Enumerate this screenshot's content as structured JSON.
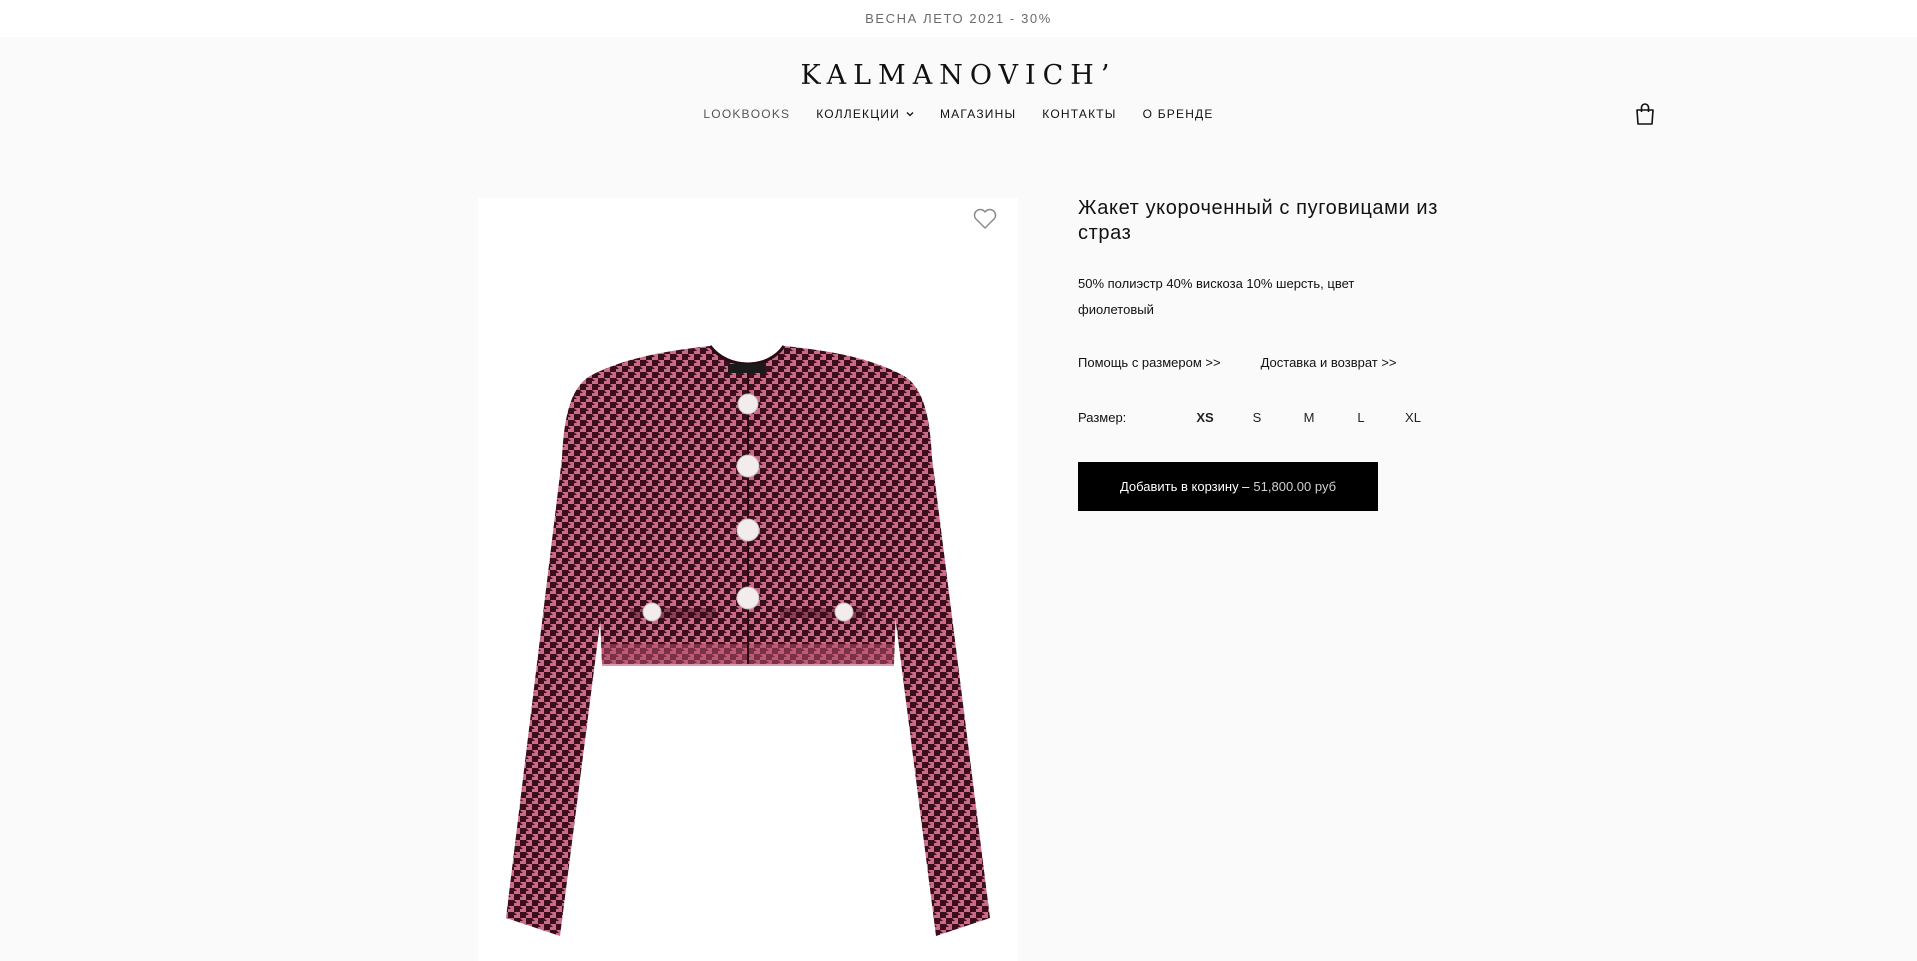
{
  "promo": {
    "text": "ВЕСНА ЛЕТО 2021 - 30%"
  },
  "brand": {
    "logo": "KALMANOVICH’"
  },
  "nav": {
    "lookbooks": "LOOKBOOKS",
    "collections": "КОЛЛЕКЦИИ",
    "stores": "МАГАЗИНЫ",
    "contacts": "КОНТАКТЫ",
    "about": "О БРЕНДЕ"
  },
  "icons": {
    "cart": "shopping-bag-icon",
    "wishlist": "heart-icon",
    "dropdown": "chevron-down-icon"
  },
  "product": {
    "title": "Жакет укороченный с пуговицами из страз",
    "composition": "50% полиэстр 40% вискоза 10% шерсть, цвет фиолетовый",
    "size_help": "Помощь с размером >>",
    "delivery": "Доставка и возврат >>",
    "size_label": "Размер:",
    "sizes": [
      "XS",
      "S",
      "M",
      "L",
      "XL"
    ],
    "selected_size": "XS",
    "add_to_cart": "Добавить в корзину –",
    "price": "51,800.00 руб"
  },
  "colors": {
    "accent": "#000000",
    "background": "#fafafa",
    "jacket_pink": "#c95b79",
    "jacket_dark": "#3a0f1c"
  }
}
